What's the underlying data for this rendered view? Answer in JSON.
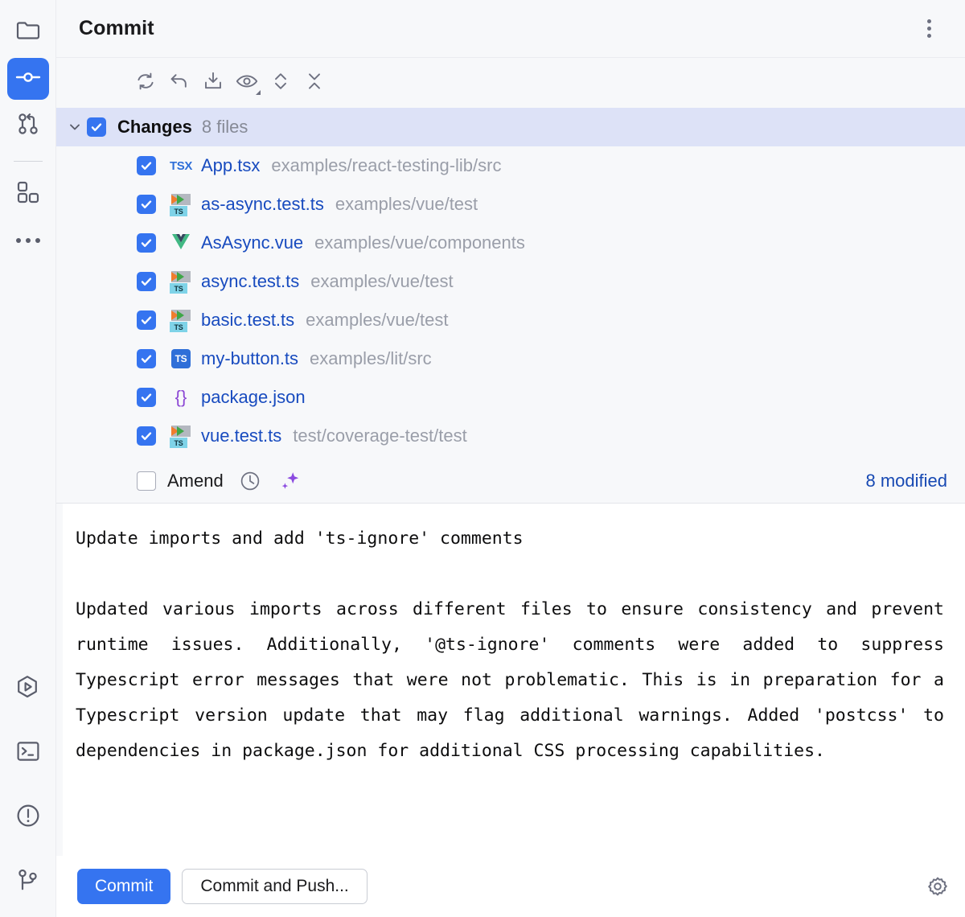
{
  "activity_bar": {
    "top_items": [
      {
        "name": "project-folder",
        "icon": "folder-icon",
        "active": false
      },
      {
        "name": "commit",
        "icon": "commit-node-icon",
        "active": true
      },
      {
        "name": "pull-requests",
        "icon": "pull-request-icon",
        "active": false
      },
      {
        "name": "plugins",
        "icon": "plugins-grid-icon",
        "active": false
      },
      {
        "name": "more-tool-windows",
        "icon": "more-dots-icon",
        "active": false
      }
    ],
    "bottom_items": [
      {
        "name": "run",
        "icon": "run-play-icon"
      },
      {
        "name": "terminal",
        "icon": "terminal-icon"
      },
      {
        "name": "problems",
        "icon": "warning-circle-icon"
      },
      {
        "name": "git-branches",
        "icon": "git-branch-icon"
      }
    ]
  },
  "header": {
    "title": "Commit",
    "options_icon": "vertical-dots-icon",
    "minimize_icon": "minimize-icon"
  },
  "toolbar": {
    "buttons": [
      {
        "name": "refresh-changes",
        "icon": "refresh-icon",
        "label": "Refresh Changes"
      },
      {
        "name": "rollback",
        "icon": "rollback-undo-icon",
        "label": "Rollback"
      },
      {
        "name": "update-project",
        "icon": "download-update-icon",
        "label": "Update Project"
      },
      {
        "name": "show-diff-preview",
        "icon": "eye-icon",
        "label": "Show Diff Preview",
        "has_dropdown": true
      },
      {
        "name": "expand-collapse",
        "icon": "chevron-up-down-icon",
        "label": "Expand or Collapse"
      },
      {
        "name": "collapse-all",
        "icon": "collapse-all-icon",
        "label": "Collapse All"
      }
    ]
  },
  "changes": {
    "group": {
      "label": "Changes",
      "count_label": "8 files",
      "checked": true,
      "expanded": true,
      "chevron_icon": "chevron-down-icon"
    },
    "files": [
      {
        "name": "App.tsx",
        "path": "examples/react-testing-lib/src",
        "icon": "tsx-file-icon",
        "icon_kind": "tsx",
        "checked": true
      },
      {
        "name": "as-async.test.ts",
        "path": "examples/vue/test",
        "icon": "ts-test-file-icon",
        "icon_kind": "test",
        "checked": true
      },
      {
        "name": "AsAsync.vue",
        "path": "examples/vue/components",
        "icon": "vue-file-icon",
        "icon_kind": "vue",
        "checked": true
      },
      {
        "name": "async.test.ts",
        "path": "examples/vue/test",
        "icon": "ts-test-file-icon",
        "icon_kind": "test",
        "checked": true
      },
      {
        "name": "basic.test.ts",
        "path": "examples/vue/test",
        "icon": "ts-test-file-icon",
        "icon_kind": "test",
        "checked": true
      },
      {
        "name": "my-button.ts",
        "path": "examples/lit/src",
        "icon": "ts-file-icon",
        "icon_kind": "ts",
        "checked": true
      },
      {
        "name": "package.json",
        "path": "",
        "icon": "json-file-icon",
        "icon_kind": "json",
        "checked": true
      },
      {
        "name": "vue.test.ts",
        "path": "test/coverage-test/test",
        "icon": "ts-test-file-icon",
        "icon_kind": "test",
        "checked": true
      }
    ]
  },
  "amend_bar": {
    "amend_label": "Amend",
    "amend_checked": false,
    "history_icon": "clock-history-icon",
    "ai_icon": "ai-sparkle-icon",
    "modified_count": "8 modified"
  },
  "commit_message": {
    "subject": "Update imports and add 'ts-ignore' comments",
    "body": "Updated various imports across different files to ensure consistency and prevent runtime issues. Additionally, '@ts-ignore' comments were added to suppress Typescript error messages that were not problematic. This is in preparation for a Typescript version update that may flag additional warnings. Added 'postcss' to dependencies in package.json for additional CSS processing capabilities."
  },
  "footer": {
    "commit_label": "Commit",
    "commit_and_push_label": "Commit and Push...",
    "settings_icon": "gear-icon"
  },
  "colors": {
    "accent_blue": "#3574f0",
    "selection_lavender": "#dde2f7",
    "file_name_blue": "#184bbf",
    "path_gray": "#9a9ea9",
    "modified_link": "#1749b3",
    "ai_purple": "#8b4ae0",
    "panel_bg": "#f7f8fa",
    "editor_bg": "#ffffff"
  }
}
